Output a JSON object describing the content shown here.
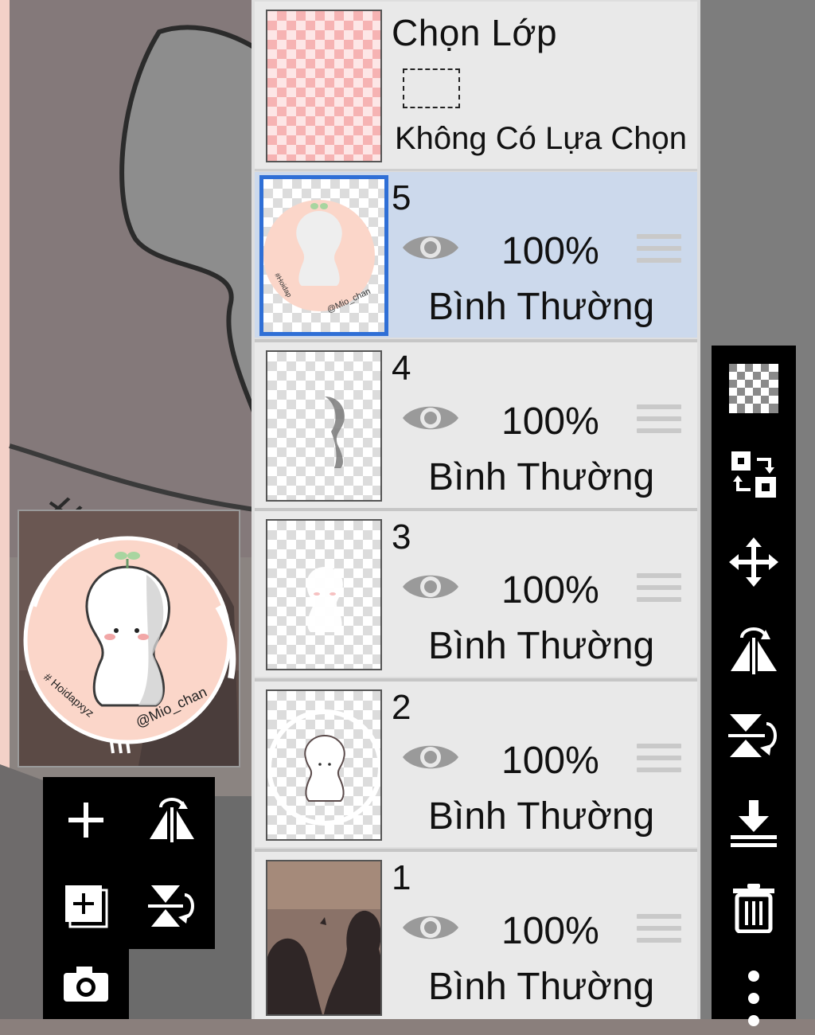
{
  "selection": {
    "title": "Chọn Lớp",
    "status": "Không Có Lựa Chọn"
  },
  "layers": [
    {
      "number": "5",
      "opacity": "100%",
      "blend": "Bình Thường",
      "active": true
    },
    {
      "number": "4",
      "opacity": "100%",
      "blend": "Bình Thường",
      "active": false
    },
    {
      "number": "3",
      "opacity": "100%",
      "blend": "Bình Thường",
      "active": false
    },
    {
      "number": "2",
      "opacity": "100%",
      "blend": "Bình Thường",
      "active": false
    },
    {
      "number": "1",
      "opacity": "100%",
      "blend": "Bình Thường",
      "active": false
    }
  ],
  "artwork_text": {
    "hashtag": "# Hoidapxyz",
    "signature": "@Mio_chan"
  },
  "left_tools": [
    "add-layer-icon",
    "flip-horizontal-icon",
    "add-layer-copy-icon",
    "flip-vertical-icon",
    "camera-icon"
  ],
  "right_tools": [
    "transparency-icon",
    "swap-layers-icon",
    "move-icon",
    "flip-horizontal-icon",
    "flip-vertical-icon",
    "merge-down-icon",
    "delete-icon",
    "more-icon"
  ],
  "colors": {
    "active_layer_bg": "#ccd9ec",
    "active_layer_border": "#2f6fd6",
    "panel_bg": "#e9e9e9",
    "toolbar_bg": "#000000",
    "artwork_peach": "#fbd6c9"
  }
}
